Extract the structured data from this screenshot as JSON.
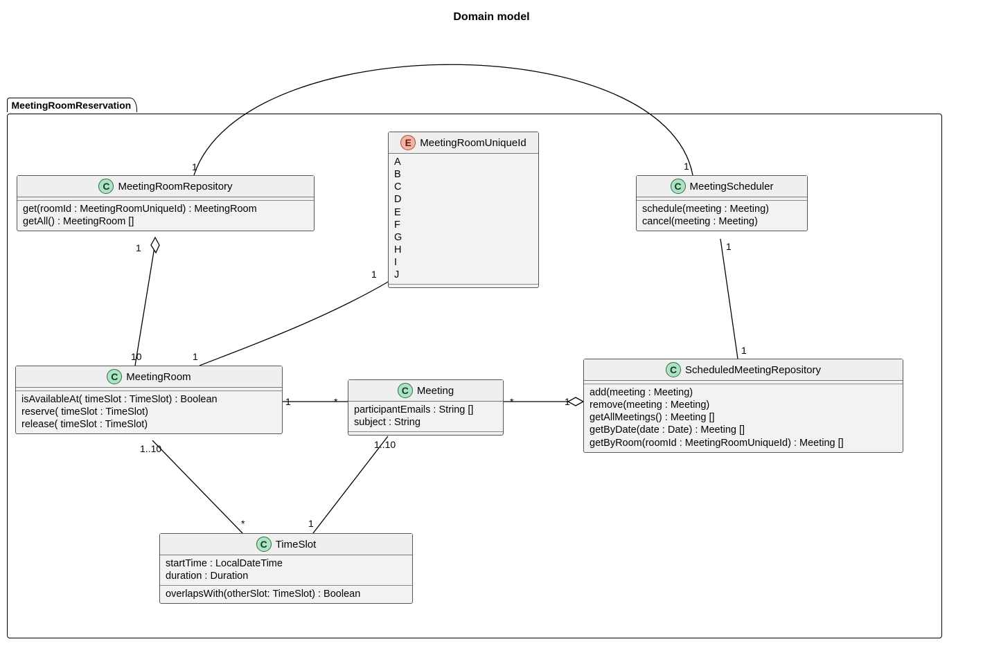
{
  "title": "Domain model",
  "package": {
    "name": "MeetingRoomReservation"
  },
  "classes": {
    "meetingRoomRepository": {
      "name": "MeetingRoomRepository",
      "kind": "C",
      "methods": [
        "get(roomId : MeetingRoomUniqueId) : MeetingRoom",
        "getAll() : MeetingRoom []"
      ]
    },
    "meetingRoomUniqueId": {
      "name": "MeetingRoomUniqueId",
      "kind": "E",
      "literals": [
        "A",
        "B",
        "C",
        "D",
        "E",
        "F",
        "G",
        "H",
        "I",
        "J"
      ]
    },
    "meetingScheduler": {
      "name": "MeetingScheduler",
      "kind": "C",
      "methods": [
        "schedule(meeting : Meeting)",
        "cancel(meeting : Meeting)"
      ]
    },
    "meetingRoom": {
      "name": "MeetingRoom",
      "kind": "C",
      "methods": [
        "isAvailableAt( timeSlot : TimeSlot) : Boolean",
        "reserve( timeSlot : TimeSlot)",
        "release( timeSlot : TimeSlot)"
      ]
    },
    "meeting": {
      "name": "Meeting",
      "kind": "C",
      "attributes": [
        "participantEmails : String []",
        "subject : String"
      ]
    },
    "scheduledMeetingRepository": {
      "name": "ScheduledMeetingRepository",
      "kind": "C",
      "methods": [
        "add(meeting : Meeting)",
        "remove(meeting : Meeting)",
        "getAllMeetings() : Meeting []",
        "getByDate(date : Date) : Meeting []",
        "getByRoom(roomId : MeetingRoomUniqueId) : Meeting []"
      ]
    },
    "timeSlot": {
      "name": "TimeSlot",
      "kind": "C",
      "attributes": [
        "startTime : LocalDateTime",
        "duration : Duration"
      ],
      "methods": [
        "overlapsWith(otherSlot: TimeSlot) : Boolean"
      ]
    }
  },
  "multiplicities": {
    "repo_top": "1",
    "repo_bottom": "1",
    "room_up_left": "10",
    "room_up_right": "1",
    "room_right": "1",
    "room_down": "1..10",
    "uniqueId_bottom": "1",
    "meeting_left": "*",
    "meeting_right": "*",
    "meeting_down": "1..10",
    "timeslot_left": "*",
    "timeslot_right": "1",
    "schedRepo_left": "1",
    "schedRepo_top": "1",
    "scheduler_top": "1",
    "scheduler_bottom": "1"
  }
}
